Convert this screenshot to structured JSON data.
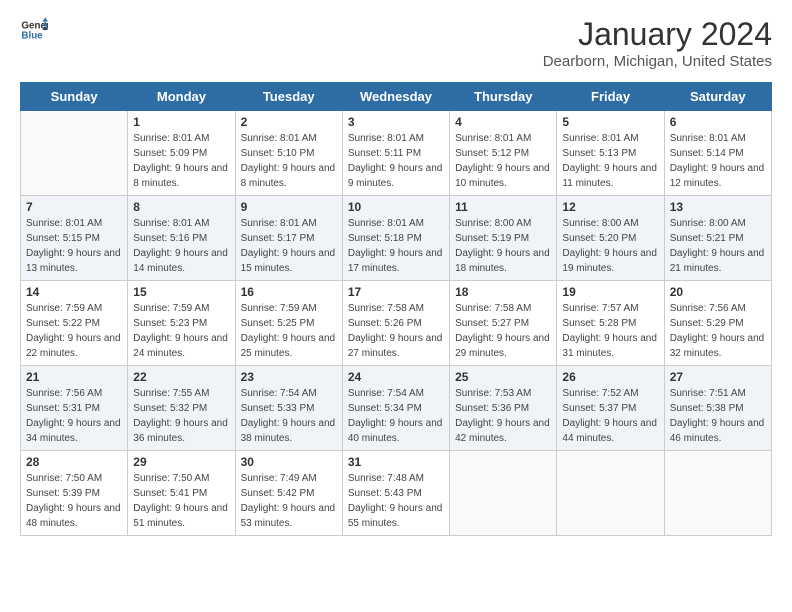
{
  "header": {
    "logo_line1": "General",
    "logo_line2": "Blue",
    "title": "January 2024",
    "subtitle": "Dearborn, Michigan, United States"
  },
  "days_of_week": [
    "Sunday",
    "Monday",
    "Tuesday",
    "Wednesday",
    "Thursday",
    "Friday",
    "Saturday"
  ],
  "weeks": [
    [
      {
        "day": "",
        "sunrise": "",
        "sunset": "",
        "daylight": "",
        "empty": true
      },
      {
        "day": "1",
        "sunrise": "Sunrise: 8:01 AM",
        "sunset": "Sunset: 5:09 PM",
        "daylight": "Daylight: 9 hours and 8 minutes."
      },
      {
        "day": "2",
        "sunrise": "Sunrise: 8:01 AM",
        "sunset": "Sunset: 5:10 PM",
        "daylight": "Daylight: 9 hours and 8 minutes."
      },
      {
        "day": "3",
        "sunrise": "Sunrise: 8:01 AM",
        "sunset": "Sunset: 5:11 PM",
        "daylight": "Daylight: 9 hours and 9 minutes."
      },
      {
        "day": "4",
        "sunrise": "Sunrise: 8:01 AM",
        "sunset": "Sunset: 5:12 PM",
        "daylight": "Daylight: 9 hours and 10 minutes."
      },
      {
        "day": "5",
        "sunrise": "Sunrise: 8:01 AM",
        "sunset": "Sunset: 5:13 PM",
        "daylight": "Daylight: 9 hours and 11 minutes."
      },
      {
        "day": "6",
        "sunrise": "Sunrise: 8:01 AM",
        "sunset": "Sunset: 5:14 PM",
        "daylight": "Daylight: 9 hours and 12 minutes."
      }
    ],
    [
      {
        "day": "7",
        "sunrise": "Sunrise: 8:01 AM",
        "sunset": "Sunset: 5:15 PM",
        "daylight": "Daylight: 9 hours and 13 minutes."
      },
      {
        "day": "8",
        "sunrise": "Sunrise: 8:01 AM",
        "sunset": "Sunset: 5:16 PM",
        "daylight": "Daylight: 9 hours and 14 minutes."
      },
      {
        "day": "9",
        "sunrise": "Sunrise: 8:01 AM",
        "sunset": "Sunset: 5:17 PM",
        "daylight": "Daylight: 9 hours and 15 minutes."
      },
      {
        "day": "10",
        "sunrise": "Sunrise: 8:01 AM",
        "sunset": "Sunset: 5:18 PM",
        "daylight": "Daylight: 9 hours and 17 minutes."
      },
      {
        "day": "11",
        "sunrise": "Sunrise: 8:00 AM",
        "sunset": "Sunset: 5:19 PM",
        "daylight": "Daylight: 9 hours and 18 minutes."
      },
      {
        "day": "12",
        "sunrise": "Sunrise: 8:00 AM",
        "sunset": "Sunset: 5:20 PM",
        "daylight": "Daylight: 9 hours and 19 minutes."
      },
      {
        "day": "13",
        "sunrise": "Sunrise: 8:00 AM",
        "sunset": "Sunset: 5:21 PM",
        "daylight": "Daylight: 9 hours and 21 minutes."
      }
    ],
    [
      {
        "day": "14",
        "sunrise": "Sunrise: 7:59 AM",
        "sunset": "Sunset: 5:22 PM",
        "daylight": "Daylight: 9 hours and 22 minutes."
      },
      {
        "day": "15",
        "sunrise": "Sunrise: 7:59 AM",
        "sunset": "Sunset: 5:23 PM",
        "daylight": "Daylight: 9 hours and 24 minutes."
      },
      {
        "day": "16",
        "sunrise": "Sunrise: 7:59 AM",
        "sunset": "Sunset: 5:25 PM",
        "daylight": "Daylight: 9 hours and 25 minutes."
      },
      {
        "day": "17",
        "sunrise": "Sunrise: 7:58 AM",
        "sunset": "Sunset: 5:26 PM",
        "daylight": "Daylight: 9 hours and 27 minutes."
      },
      {
        "day": "18",
        "sunrise": "Sunrise: 7:58 AM",
        "sunset": "Sunset: 5:27 PM",
        "daylight": "Daylight: 9 hours and 29 minutes."
      },
      {
        "day": "19",
        "sunrise": "Sunrise: 7:57 AM",
        "sunset": "Sunset: 5:28 PM",
        "daylight": "Daylight: 9 hours and 31 minutes."
      },
      {
        "day": "20",
        "sunrise": "Sunrise: 7:56 AM",
        "sunset": "Sunset: 5:29 PM",
        "daylight": "Daylight: 9 hours and 32 minutes."
      }
    ],
    [
      {
        "day": "21",
        "sunrise": "Sunrise: 7:56 AM",
        "sunset": "Sunset: 5:31 PM",
        "daylight": "Daylight: 9 hours and 34 minutes."
      },
      {
        "day": "22",
        "sunrise": "Sunrise: 7:55 AM",
        "sunset": "Sunset: 5:32 PM",
        "daylight": "Daylight: 9 hours and 36 minutes."
      },
      {
        "day": "23",
        "sunrise": "Sunrise: 7:54 AM",
        "sunset": "Sunset: 5:33 PM",
        "daylight": "Daylight: 9 hours and 38 minutes."
      },
      {
        "day": "24",
        "sunrise": "Sunrise: 7:54 AM",
        "sunset": "Sunset: 5:34 PM",
        "daylight": "Daylight: 9 hours and 40 minutes."
      },
      {
        "day": "25",
        "sunrise": "Sunrise: 7:53 AM",
        "sunset": "Sunset: 5:36 PM",
        "daylight": "Daylight: 9 hours and 42 minutes."
      },
      {
        "day": "26",
        "sunrise": "Sunrise: 7:52 AM",
        "sunset": "Sunset: 5:37 PM",
        "daylight": "Daylight: 9 hours and 44 minutes."
      },
      {
        "day": "27",
        "sunrise": "Sunrise: 7:51 AM",
        "sunset": "Sunset: 5:38 PM",
        "daylight": "Daylight: 9 hours and 46 minutes."
      }
    ],
    [
      {
        "day": "28",
        "sunrise": "Sunrise: 7:50 AM",
        "sunset": "Sunset: 5:39 PM",
        "daylight": "Daylight: 9 hours and 48 minutes."
      },
      {
        "day": "29",
        "sunrise": "Sunrise: 7:50 AM",
        "sunset": "Sunset: 5:41 PM",
        "daylight": "Daylight: 9 hours and 51 minutes."
      },
      {
        "day": "30",
        "sunrise": "Sunrise: 7:49 AM",
        "sunset": "Sunset: 5:42 PM",
        "daylight": "Daylight: 9 hours and 53 minutes."
      },
      {
        "day": "31",
        "sunrise": "Sunrise: 7:48 AM",
        "sunset": "Sunset: 5:43 PM",
        "daylight": "Daylight: 9 hours and 55 minutes."
      },
      {
        "day": "",
        "sunrise": "",
        "sunset": "",
        "daylight": "",
        "empty": true
      },
      {
        "day": "",
        "sunrise": "",
        "sunset": "",
        "daylight": "",
        "empty": true
      },
      {
        "day": "",
        "sunrise": "",
        "sunset": "",
        "daylight": "",
        "empty": true
      }
    ]
  ]
}
